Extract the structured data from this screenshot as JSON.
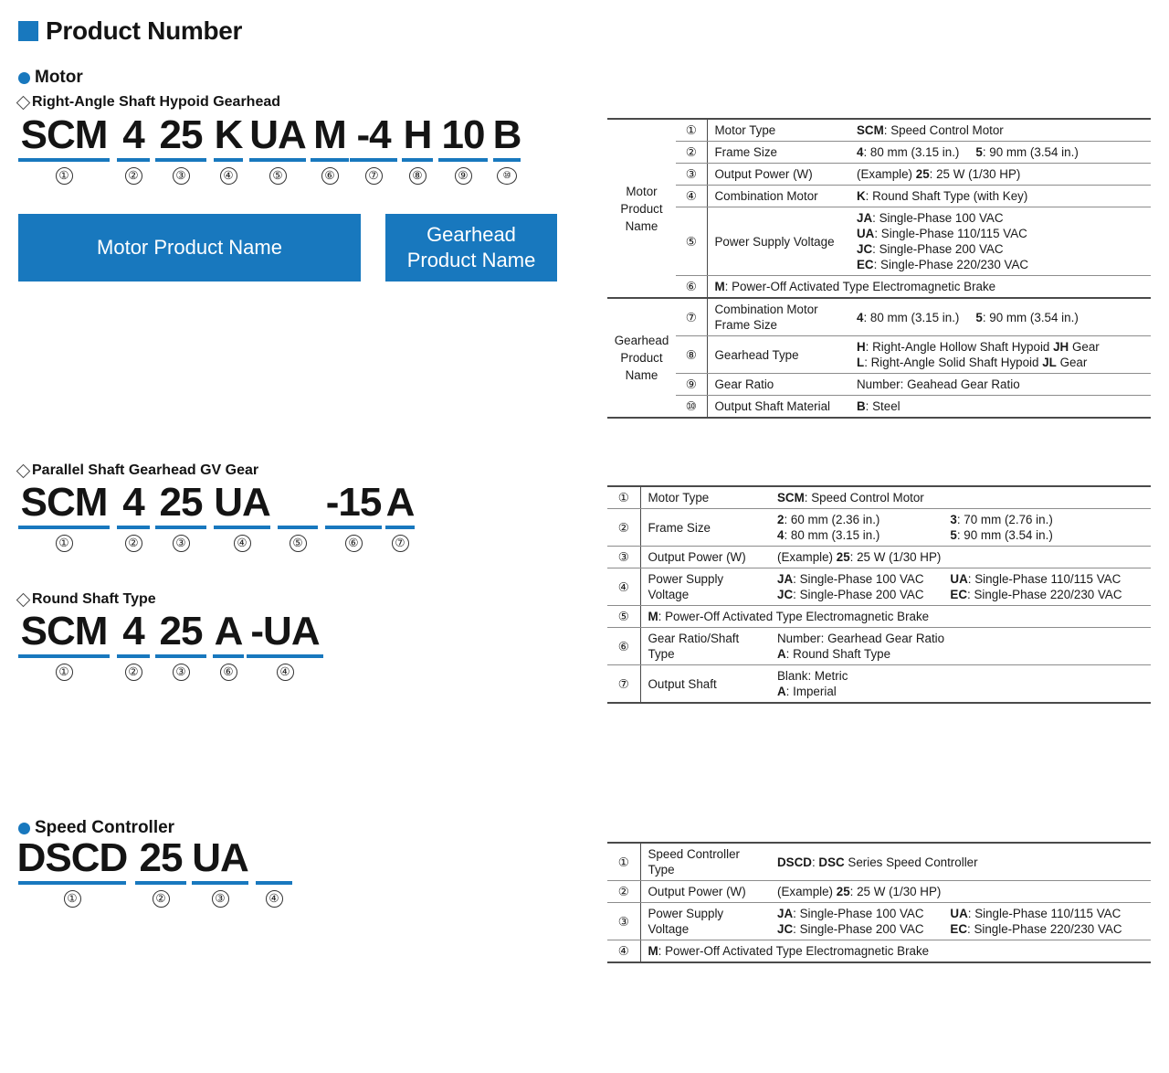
{
  "page": {
    "title": "Product Number"
  },
  "sections": {
    "motor": {
      "heading": "Motor",
      "sub1": {
        "heading_plain": "Right-Angle Shaft Hypoid Gearhead",
        "product_number": "SCM 4 25 K UA M - 4 H 10 B",
        "segments": [
          {
            "text": "SCM",
            "num": "①"
          },
          {
            "text": "4",
            "num": "②"
          },
          {
            "text": "25",
            "num": "③"
          },
          {
            "text": "K",
            "num": "④"
          },
          {
            "text": "UA",
            "num": "⑤"
          },
          {
            "text": "M",
            "num": "⑥"
          },
          {
            "text": "-4",
            "num": "⑦"
          },
          {
            "text": "H",
            "num": "⑧"
          },
          {
            "text": "10",
            "num": "⑨"
          },
          {
            "text": "B",
            "num": "⑩"
          }
        ],
        "box_motor": "Motor Product Name",
        "box_gearhead": "Gearhead\nProduct Name"
      },
      "sub2": {
        "heading_pre": "Parallel Shaft Gearhead ",
        "heading_bold": "GV",
        "heading_post": " Gear",
        "segments": [
          {
            "text": "SCM",
            "num": "①"
          },
          {
            "text": "4",
            "num": "②"
          },
          {
            "text": "25",
            "num": "③"
          },
          {
            "text": "UA",
            "num": "④"
          },
          {
            "text": "",
            "num": "⑤"
          },
          {
            "text": "-15",
            "num": "⑥"
          },
          {
            "text": "A",
            "num": "⑦"
          }
        ]
      },
      "sub3": {
        "heading_plain": "Round Shaft Type",
        "segments": [
          {
            "text": "SCM",
            "num": "①"
          },
          {
            "text": "4",
            "num": "②"
          },
          {
            "text": "25",
            "num": "③"
          },
          {
            "text": "A",
            "num": "⑥"
          },
          {
            "text": "-UA",
            "num": "④"
          }
        ]
      }
    },
    "speed_controller": {
      "heading": "Speed Controller",
      "segments": [
        {
          "text": "DSCD",
          "num": "①"
        },
        {
          "text": "25",
          "num": "②"
        },
        {
          "text": "UA",
          "num": "③"
        },
        {
          "text": "",
          "num": "④"
        }
      ]
    }
  },
  "table_gearhead": {
    "group_motor": "Motor\nProduct\nName",
    "group_gearhead": "Gearhead\nProduct\nName",
    "rows": [
      {
        "idx": "①",
        "label": "Motor Type",
        "value_bold": "SCM",
        "value_rest": ": Speed Control Motor"
      },
      {
        "idx": "②",
        "label": "Frame Size",
        "pairs": [
          [
            "4",
            ": 80 mm (3.15 in.)"
          ],
          [
            "5",
            ": 90 mm (3.54 in.)"
          ]
        ]
      },
      {
        "idx": "③",
        "label": "Output Power (W)",
        "prefix": "(Example) ",
        "value_bold": "25",
        "value_rest": ": 25 W (1/30 HP)"
      },
      {
        "idx": "④",
        "label": "Combination Motor",
        "value_bold": "K",
        "value_rest": ": Round Shaft Type (with Key)"
      },
      {
        "idx": "⑤",
        "label": "Power Supply Voltage",
        "lines": [
          {
            "b": "JA",
            "t": ": Single-Phase 100 VAC"
          },
          {
            "b": "UA",
            "t": ": Single-Phase 110/115 VAC"
          },
          {
            "b": "JC",
            "t": ": Single-Phase 200 VAC"
          },
          {
            "b": "EC",
            "t": ": Single-Phase 220/230 VAC"
          }
        ]
      },
      {
        "idx": "⑥",
        "label": "",
        "value_bold": "M",
        "value_rest": ": Power-Off Activated Type Electromagnetic Brake",
        "span": true
      },
      {
        "idx": "⑦",
        "label": "Combination Motor\nFrame Size",
        "pairs": [
          [
            "4",
            ": 80 mm (3.15 in.)"
          ],
          [
            "5",
            ": 90 mm (3.54 in.)"
          ]
        ]
      },
      {
        "idx": "⑧",
        "label": "Gearhead Type",
        "lines": [
          {
            "b": "H",
            "t": ": Right-Angle Hollow Shaft Hypoid ",
            "b2": "JH",
            "t2": " Gear"
          },
          {
            "b": "L",
            "t": ": Right-Angle Solid Shaft Hypoid ",
            "b2": "JL",
            "t2": " Gear"
          }
        ]
      },
      {
        "idx": "⑨",
        "label": "Gear Ratio",
        "value_rest": "Number: Geahead Gear Ratio"
      },
      {
        "idx": "⑩",
        "label": "Output Shaft Material",
        "value_bold": "B",
        "value_rest": ": Steel"
      }
    ]
  },
  "table_parallel": {
    "rows": [
      {
        "idx": "①",
        "label": "Motor Type",
        "value_bold": "SCM",
        "value_rest": ": Speed Control Motor"
      },
      {
        "idx": "②",
        "label": "Frame Size",
        "grid": [
          [
            {
              "b": "2",
              "t": ": 60 mm (2.36 in.)"
            },
            {
              "b": "3",
              "t": ": 70 mm (2.76 in.)"
            }
          ],
          [
            {
              "b": "4",
              "t": ": 80 mm (3.15 in.)"
            },
            {
              "b": "5",
              "t": ": 90 mm (3.54 in.)"
            }
          ]
        ]
      },
      {
        "idx": "③",
        "label": "Output Power (W)",
        "prefix": "(Example) ",
        "value_bold": "25",
        "value_rest": ": 25 W (1/30 HP)"
      },
      {
        "idx": "④",
        "label": "Power Supply Voltage",
        "grid": [
          [
            {
              "b": "JA",
              "t": ": Single-Phase 100 VAC"
            },
            {
              "b": "UA",
              "t": ": Single-Phase 110/115 VAC"
            }
          ],
          [
            {
              "b": "JC",
              "t": ": Single-Phase 200 VAC"
            },
            {
              "b": "EC",
              "t": ": Single-Phase 220/230 VAC"
            }
          ]
        ]
      },
      {
        "idx": "⑤",
        "label": "",
        "value_bold": "M",
        "value_rest": ": Power-Off Activated Type Electromagnetic Brake",
        "span": true
      },
      {
        "idx": "⑥",
        "label": "Gear Ratio/Shaft\nType",
        "lines": [
          {
            "t": "Number: Gearhead Gear Ratio"
          },
          {
            "b": "A",
            "t": ": Round Shaft Type"
          }
        ]
      },
      {
        "idx": "⑦",
        "label": "Output Shaft",
        "lines": [
          {
            "t": "Blank: Metric"
          },
          {
            "b": "A",
            "t": ": Imperial"
          }
        ]
      }
    ]
  },
  "table_controller": {
    "rows": [
      {
        "idx": "①",
        "label": "Speed Controller\nType",
        "value_bold": "DSCD",
        "value_mid": ": ",
        "value_bold2": "DSC",
        "value_rest": " Series Speed Controller"
      },
      {
        "idx": "②",
        "label": "Output Power (W)",
        "prefix": "(Example) ",
        "value_bold": "25",
        "value_rest": ": 25 W (1/30 HP)"
      },
      {
        "idx": "③",
        "label": "Power Supply Voltage",
        "grid": [
          [
            {
              "b": "JA",
              "t": ": Single-Phase 100 VAC"
            },
            {
              "b": "UA",
              "t": ": Single-Phase 110/115 VAC"
            }
          ],
          [
            {
              "b": "JC",
              "t": ": Single-Phase 200 VAC"
            },
            {
              "b": "EC",
              "t": ": Single-Phase 220/230 VAC"
            }
          ]
        ]
      },
      {
        "idx": "④",
        "label": "",
        "value_bold": "M",
        "value_rest": ": Power-Off Activated Type Electromagnetic Brake",
        "span": true
      }
    ]
  },
  "colors": {
    "accent_blue": "#1878be",
    "rule_gray": "#8c8c8c",
    "text": "#1a1a1a"
  }
}
